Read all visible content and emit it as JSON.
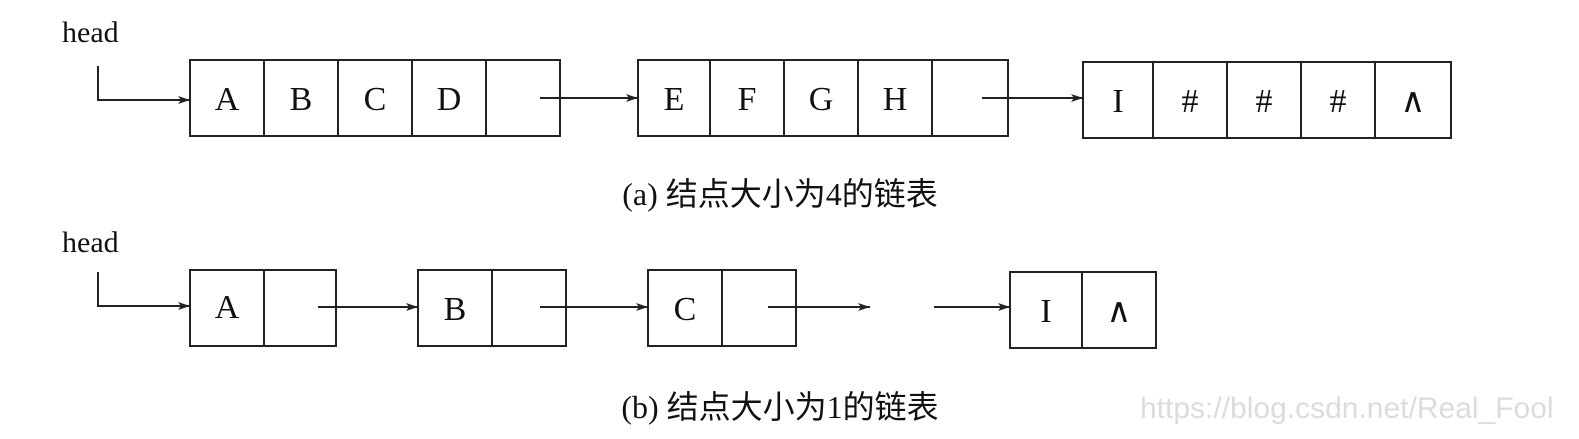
{
  "diagram_a": {
    "head_label": "head",
    "nodes": [
      {
        "cells": [
          "A",
          "B",
          "C",
          "D",
          ""
        ]
      },
      {
        "cells": [
          "E",
          "F",
          "G",
          "H",
          ""
        ]
      },
      {
        "cells": [
          "I",
          "#",
          "#",
          "#",
          "∧"
        ]
      }
    ],
    "caption": "(a) 结点大小为4的链表"
  },
  "diagram_b": {
    "head_label": "head",
    "nodes": [
      {
        "cells": [
          "A",
          ""
        ]
      },
      {
        "cells": [
          "B",
          ""
        ]
      },
      {
        "cells": [
          "C",
          ""
        ]
      },
      {
        "cells": [
          "I",
          "∧"
        ]
      }
    ],
    "caption": "(b) 结点大小为1的链表"
  },
  "watermark": "https://blog.csdn.net/Real_Fool",
  "colors": {
    "line": "#222222",
    "watermark": "#dcdcdc"
  }
}
